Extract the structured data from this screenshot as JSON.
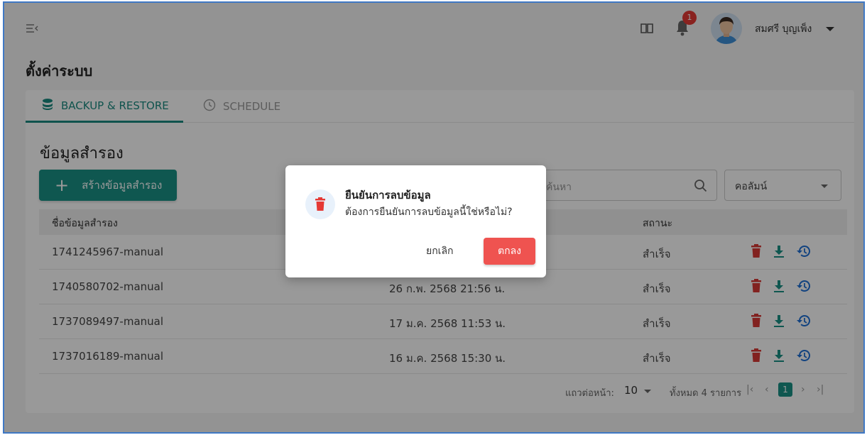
{
  "header": {
    "notifications_count": "1",
    "user_name": "สมศรี บุญเพ็ง"
  },
  "page": {
    "title": "ตั้งค่าระบบ"
  },
  "tabs": [
    {
      "label": "BACKUP & RESTORE",
      "active": true
    },
    {
      "label": "SCHEDULE",
      "active": false
    }
  ],
  "section": {
    "title": "ข้อมูลสำรอง",
    "add_button": "สร้างข้อมูลสำรอง",
    "search_placeholder": "ค้นหา",
    "column_select": "คอลัมน์"
  },
  "table": {
    "columns": [
      "ชื่อข้อมูลสำรอง",
      "",
      "สถานะ"
    ],
    "rows": [
      {
        "name": "1741245967-manual",
        "date": "",
        "status": "สำเร็จ"
      },
      {
        "name": "1740580702-manual",
        "date": "26 ก.พ. 2568 21:56 น.",
        "status": "สำเร็จ"
      },
      {
        "name": "1737089497-manual",
        "date": "17 ม.ค. 2568 11:53 น.",
        "status": "สำเร็จ"
      },
      {
        "name": "1737016189-manual",
        "date": "16 ม.ค. 2568 15:30 น.",
        "status": "สำเร็จ"
      }
    ]
  },
  "pagination": {
    "rows_per_page_label": "แถวต่อหน้า:",
    "rows_per_page": "10",
    "total": "ทั้งหมด 4 รายการ",
    "current_page": "1"
  },
  "dialog": {
    "title": "ยืนยันการลบข้อมูล",
    "message": "ต้องการยืนยันการลบข้อมูลนี้ใช่หรือไม่?",
    "cancel": "ยกเลิก",
    "confirm": "ตกลง"
  },
  "colors": {
    "primary": "#1a9186",
    "danger": "#e53935",
    "confirm": "#ef5350"
  }
}
